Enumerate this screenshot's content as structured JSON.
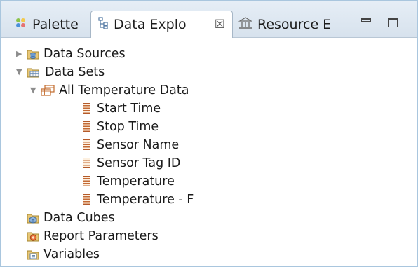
{
  "tabs": [
    {
      "label": "Palette",
      "icon": "palette-icon",
      "active": false
    },
    {
      "label": "Data Explo",
      "icon": "data-explorer-icon",
      "active": true,
      "close_glyph": "☒"
    },
    {
      "label": "Resource E",
      "icon": "resource-explorer-icon",
      "active": false
    }
  ],
  "tree": {
    "data_sources": "Data Sources",
    "data_sets": "Data Sets",
    "data_set_name": "All Temperature Data",
    "columns": [
      "Start Time",
      "Stop Time",
      "Sensor Name",
      "Sensor Tag ID",
      "Temperature",
      "Temperature - F"
    ],
    "data_cubes": "Data Cubes",
    "report_parameters": "Report Parameters",
    "variables": "Variables"
  },
  "colors": {
    "border": "#a9c6de",
    "tab_bg": "#dfe8f1",
    "column_icon": "#b45a2a",
    "folder": "#c9a04a"
  }
}
